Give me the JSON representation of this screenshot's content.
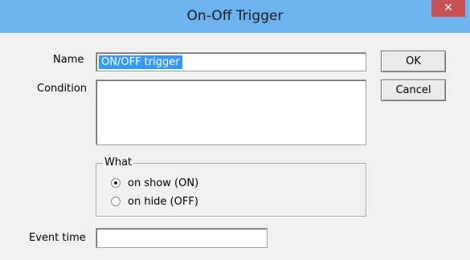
{
  "window": {
    "title": "On-Off Trigger",
    "close_glyph": "✕"
  },
  "form": {
    "name_label": "Name",
    "name_value": "ON/OFF trigger",
    "condition_label": "Condition",
    "condition_value": "",
    "event_time_label": "Event time",
    "event_time_value": ""
  },
  "buttons": {
    "ok_label": "OK",
    "cancel_label": "Cancel"
  },
  "what_group": {
    "legend": "What",
    "options": [
      {
        "label": "on show (ON)",
        "checked": true
      },
      {
        "label": "on hide (OFF)",
        "checked": false
      }
    ]
  },
  "colors": {
    "titlebar": "#6db3ed",
    "close_button": "#c75050",
    "selection": "#3399ff",
    "dialog_background": "#f0f0f0"
  }
}
